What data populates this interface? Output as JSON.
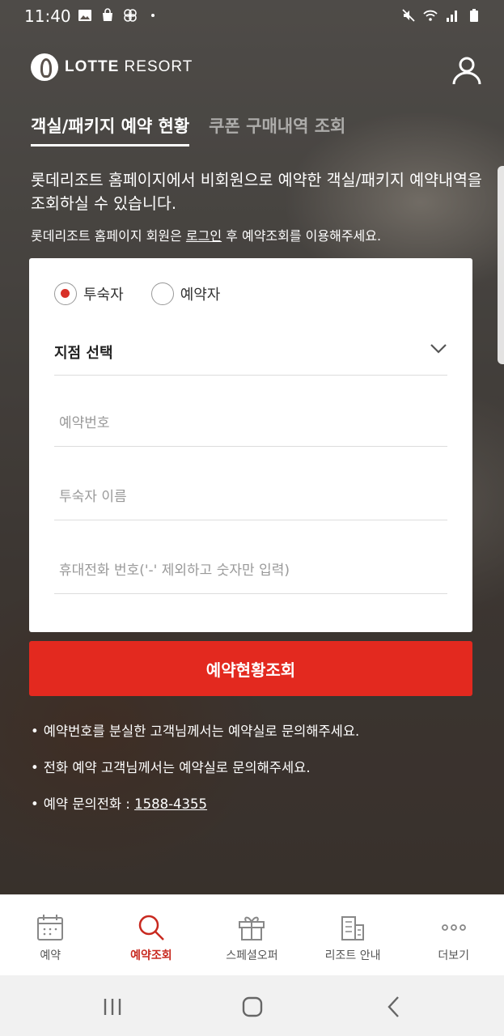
{
  "status_bar": {
    "time": "11:40",
    "left_icons": [
      "image-icon",
      "shopping-bag-icon",
      "pinwheel-icon",
      "dot-icon"
    ],
    "right_icons": [
      "mute-icon",
      "wifi-icon",
      "signal-icon",
      "battery-icon"
    ]
  },
  "header": {
    "brand_bold": "LOTTE",
    "brand_light": " RESORT",
    "user_icon": "user-icon"
  },
  "tabs": [
    {
      "label": "객실/패키지 예약 현황",
      "active": true
    },
    {
      "label": "쿠폰 구매내역 조회",
      "active": false
    }
  ],
  "intro": {
    "text": "롯데리조트 홈페이지에서 비회원으로 예약한 객실/패키지 예약내역을 조회하실 수 있습니다.",
    "note_prefix": "롯데리조트 홈페이지 회원은 ",
    "note_link": "로그인",
    "note_suffix": " 후 예약조회를 이용해주세요."
  },
  "form": {
    "radios": [
      {
        "label": "투숙자",
        "checked": true
      },
      {
        "label": "예약자",
        "checked": false
      }
    ],
    "branch_select": {
      "label": "지점 선택",
      "icon": "chevron-down-icon"
    },
    "reservation_number": {
      "placeholder": "예약번호",
      "value": ""
    },
    "guest_name": {
      "placeholder": "투숙자 이름",
      "value": ""
    },
    "phone": {
      "placeholder": "휴대전화 번호('-' 제외하고 숫자만 입력)",
      "value": ""
    },
    "submit_label": "예약현황조회",
    "accent_color": "#e3291f"
  },
  "notes": [
    {
      "text": "예약번호를 분실한 고객님께서는 예약실로 문의해주세요."
    },
    {
      "text": "전화 예약 고객님께서는 예약실로 문의해주세요."
    },
    {
      "prefix": "예약 문의전화 : ",
      "phone": "1588-4355"
    }
  ],
  "bottom_nav": [
    {
      "label": "예약",
      "icon": "calendar-icon",
      "active": false
    },
    {
      "label": "예약조회",
      "icon": "search-icon",
      "active": true
    },
    {
      "label": "스페셜오퍼",
      "icon": "gift-icon",
      "active": false
    },
    {
      "label": "리조트 안내",
      "icon": "building-icon",
      "active": false
    },
    {
      "label": "더보기",
      "icon": "more-icon",
      "active": false
    }
  ],
  "system_nav": [
    "recent-apps-icon",
    "home-icon",
    "back-icon"
  ]
}
